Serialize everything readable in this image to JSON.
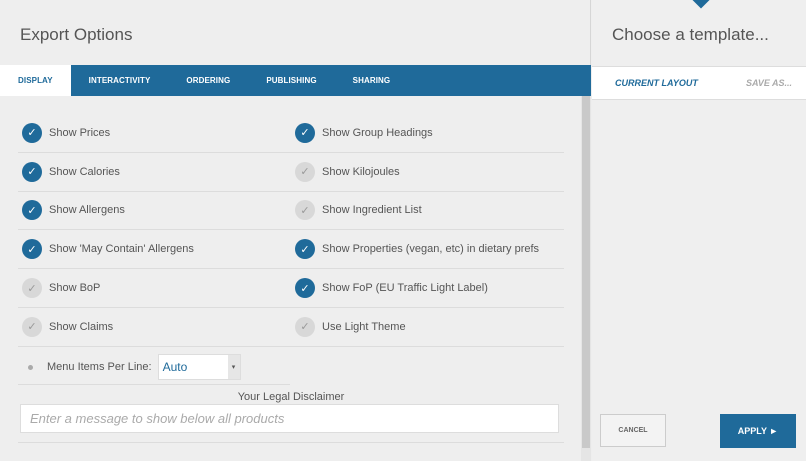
{
  "left": {
    "title": "Export Options",
    "tabs": [
      {
        "label": "DISPLAY",
        "active": true
      },
      {
        "label": "INTERACTIVITY",
        "active": false
      },
      {
        "label": "ORDERING",
        "active": false
      },
      {
        "label": "PUBLISHING",
        "active": false
      },
      {
        "label": "SHARING",
        "active": false
      }
    ],
    "options": [
      [
        {
          "label": "Show Prices",
          "checked": true
        },
        {
          "label": "Show Group Headings",
          "checked": true
        }
      ],
      [
        {
          "label": "Show Calories",
          "checked": true
        },
        {
          "label": "Show Kilojoules",
          "checked": false
        }
      ],
      [
        {
          "label": "Show Allergens",
          "checked": true
        },
        {
          "label": "Show Ingredient List",
          "checked": false
        }
      ],
      [
        {
          "label": "Show 'May Contain' Allergens",
          "checked": true
        },
        {
          "label": "Show Properties (vegan, etc) in dietary prefs",
          "checked": true
        }
      ],
      [
        {
          "label": "Show BoP",
          "checked": false
        },
        {
          "label": "Show FoP (EU Traffic Light Label)",
          "checked": true
        }
      ],
      [
        {
          "label": "Show Claims",
          "checked": false
        },
        {
          "label": "Use Light Theme",
          "checked": false
        }
      ]
    ],
    "check_glyph": "✓",
    "menu_items_per_line": {
      "label": "Menu Items Per Line:",
      "value": "Auto",
      "arrow": "▾"
    },
    "disclaimer": {
      "label": "Your Legal Disclaimer",
      "placeholder": "Enter a message to show below all products"
    }
  },
  "right": {
    "title": "Choose a template...",
    "tabs": {
      "current": "CURRENT LAYOUT",
      "save": "SAVE AS..."
    },
    "cancel": "CANCEL",
    "apply": "APPLY ►"
  },
  "colors": {
    "accent": "#1f6a9a",
    "background": "#eeeeee"
  }
}
